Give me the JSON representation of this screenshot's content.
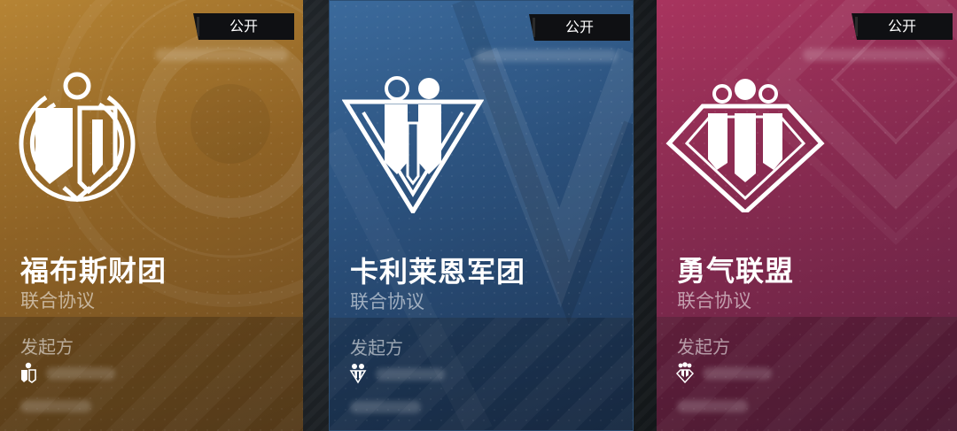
{
  "cards": [
    {
      "name": "福布斯财团",
      "type": "联合协议",
      "visibility": "公开",
      "initiator_label": "发起方",
      "emblem_icon": "forbes-consortium-emblem",
      "theme": {
        "top": "#b68434",
        "bottom": "#6b4a21"
      }
    },
    {
      "name": "卡利莱恩军团",
      "type": "联合协议",
      "visibility": "公开",
      "initiator_label": "发起方",
      "emblem_icon": "carlyle-legion-emblem",
      "theme": {
        "top": "#3b6a9c",
        "bottom": "#1d3453"
      }
    },
    {
      "name": "勇气联盟",
      "type": "联合协议",
      "visibility": "公开",
      "initiator_label": "发起方",
      "emblem_icon": "courage-alliance-emblem",
      "theme": {
        "top": "#a8345e",
        "bottom": "#5e2140"
      }
    }
  ]
}
